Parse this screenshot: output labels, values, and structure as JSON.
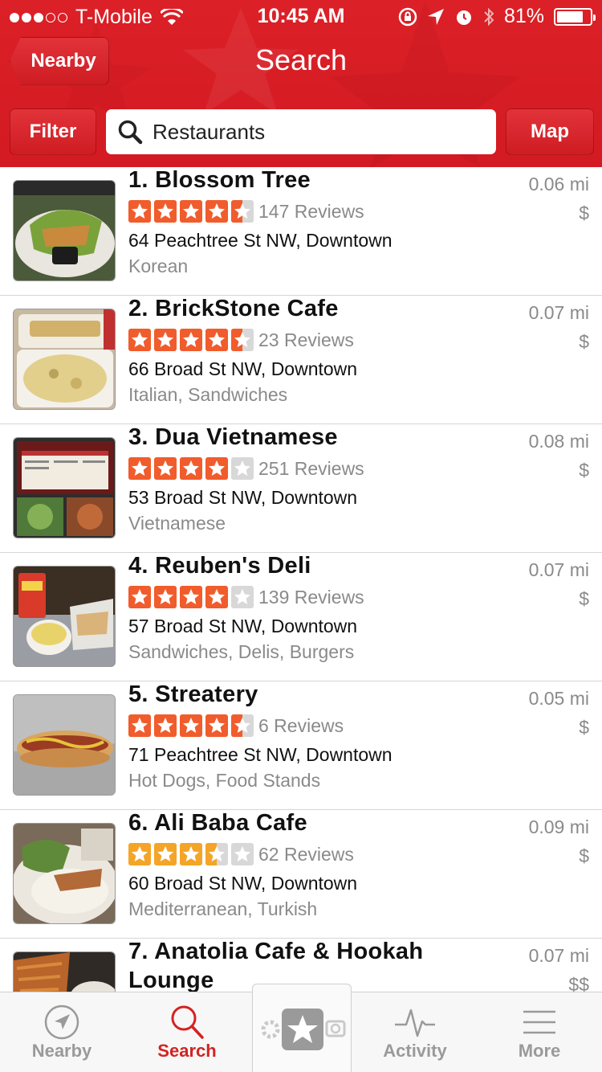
{
  "status_bar": {
    "carrier": "T-Mobile",
    "time": "10:45 AM",
    "battery": "81%",
    "battery_level": 0.81,
    "signal_bars_filled": 3,
    "signal_bars_total": 5
  },
  "nav": {
    "back_label": "Nearby",
    "title": "Search"
  },
  "toolbar": {
    "filter_label": "Filter",
    "search_value": "Restaurants",
    "map_label": "Map"
  },
  "colors": {
    "brand_red": "#d32323",
    "star_red": "#f15c2c",
    "star_orange": "#f4a528",
    "star_empty": "#d8d8d8"
  },
  "results": [
    {
      "name": "1. Blossom Tree",
      "rating": 4.5,
      "reviews": "147 Reviews",
      "address": "64 Peachtree St NW, Downtown",
      "category": "Korean",
      "distance": "0.06 mi",
      "price": "$"
    },
    {
      "name": "2. BrickStone Cafe",
      "rating": 4.5,
      "reviews": "23 Reviews",
      "address": "66 Broad St NW, Downtown",
      "category": "Italian, Sandwiches",
      "distance": "0.07 mi",
      "price": "$"
    },
    {
      "name": "3. Dua Vietnamese",
      "rating": 4,
      "reviews": "251 Reviews",
      "address": "53 Broad St NW, Downtown",
      "category": "Vietnamese",
      "distance": "0.08 mi",
      "price": "$"
    },
    {
      "name": "4. Reuben's Deli",
      "rating": 4,
      "reviews": "139 Reviews",
      "address": "57 Broad St NW, Downtown",
      "category": "Sandwiches, Delis, Burgers",
      "distance": "0.07 mi",
      "price": "$"
    },
    {
      "name": "5. Streatery",
      "rating": 4.5,
      "reviews": "6 Reviews",
      "address": "71 Peachtree St NW, Downtown",
      "category": "Hot Dogs, Food Stands",
      "distance": "0.05 mi",
      "price": "$"
    },
    {
      "name": "6. Ali Baba Cafe",
      "rating": 3.5,
      "reviews": "62 Reviews",
      "address": "60 Broad St NW, Downtown",
      "category": "Mediterranean, Turkish",
      "distance": "0.09 mi",
      "price": "$"
    },
    {
      "name": "7. Anatolia Cafe & Hookah",
      "name_line2": "Lounge",
      "distance": "0.07 mi",
      "price": "$$"
    }
  ],
  "tabbar": {
    "items": [
      {
        "label": "Nearby",
        "icon": "navigation-arrow-icon",
        "active": false
      },
      {
        "label": "Search",
        "icon": "search-icon",
        "active": true
      },
      {
        "label": "",
        "icon": "star-camera-icon",
        "active": false
      },
      {
        "label": "Activity",
        "icon": "pulse-icon",
        "active": false
      },
      {
        "label": "More",
        "icon": "menu-lines-icon",
        "active": false
      }
    ]
  }
}
